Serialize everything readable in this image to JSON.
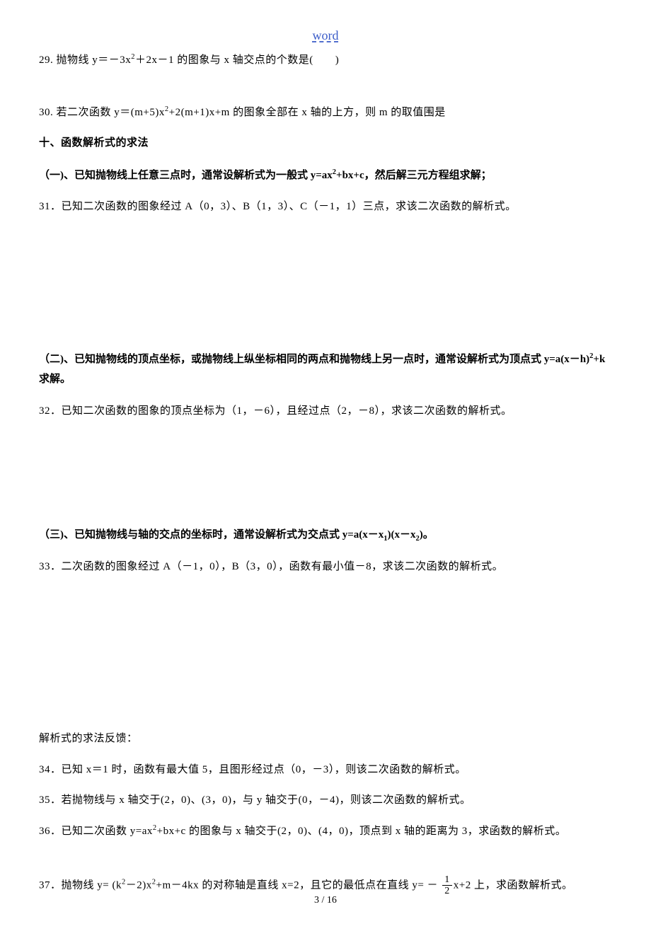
{
  "header": {
    "title": "word"
  },
  "q29": {
    "num": "29.",
    "text_a": "抛物线 y＝－3x",
    "sup1": "2",
    "text_b": "＋2x－1 的图象与 x 轴交点的个数是(　　)"
  },
  "q30": {
    "num": "30.",
    "text_a": "若二次函数 y＝(m+5)x",
    "sup1": "2",
    "text_b": "+2(m+1)x+m 的图象全部在 x 轴的上方，则 m 的取值围是"
  },
  "section10": {
    "title": "十、函数解析式的求法"
  },
  "sub1": {
    "text_a": "（一)、已知抛物线上任意三点时，通常设解析式为一般式 y=ax",
    "sup1": "2",
    "text_b": "+bx+c，然后解三元方程组求解；"
  },
  "q31": {
    "num": "31．",
    "text": "已知二次函数的图象经过 A（0，3）、B（1，3）、C（－1，1）三点，求该二次函数的解析式。"
  },
  "sub2": {
    "text_a": "（二)、已知抛物线的顶点坐标，或抛物线上纵坐标相同的两点和抛物线上另一点时，通常设解析式为顶点式 y=a(x－h)",
    "sup1": "2",
    "text_b": "+k 求解。"
  },
  "q32": {
    "num": "32．",
    "text": "已知二次函数的图象的顶点坐标为（1，－6），且经过点（2，－8），求该二次函数的解析式。"
  },
  "sub3": {
    "text_a": "（三)、已知抛物线与轴的交点的坐标时，通常设解析式为交点式 y=a(x－x",
    "sub1": "1",
    "text_b": ")(x－x",
    "sub2": "2",
    "text_c": ")。"
  },
  "q33": {
    "num": "33．",
    "text": "二次函数的图象经过 A（－1，0），B（3，0），函数有最小值－8，求该二次函数的解析式。"
  },
  "feedback": {
    "title": "解析式的求法反馈："
  },
  "q34": {
    "num": "34．",
    "text": "已知 x＝1 时，函数有最大值 5，且图形经过点（0，－3），则该二次函数的解析式。"
  },
  "q35": {
    "num": "35．",
    "text": "若抛物线与 x 轴交于(2，0)、(3，0)，与 y 轴交于(0，－4)，则该二次函数的解析式。"
  },
  "q36": {
    "num": "36．",
    "text_a": "已知二次函数 y=ax",
    "sup1": "2",
    "text_b": "+bx+c 的图象与 x 轴交于(2，0)、(4，0)，顶点到 x 轴的距离为 3，求函数的解析式。"
  },
  "q37": {
    "num": "37．",
    "text_a": "抛物线 y= (k",
    "sup1": "2",
    "text_b": "－2)x",
    "sup2": "2",
    "text_c": "+m－4kx 的对称轴是直线 x=2，且它的最低点在直线 y= －",
    "frac_top": "1",
    "frac_bot": "2",
    "text_d": "x+2 上，求函数解析式。"
  },
  "footer": {
    "page": "3 / 16"
  }
}
